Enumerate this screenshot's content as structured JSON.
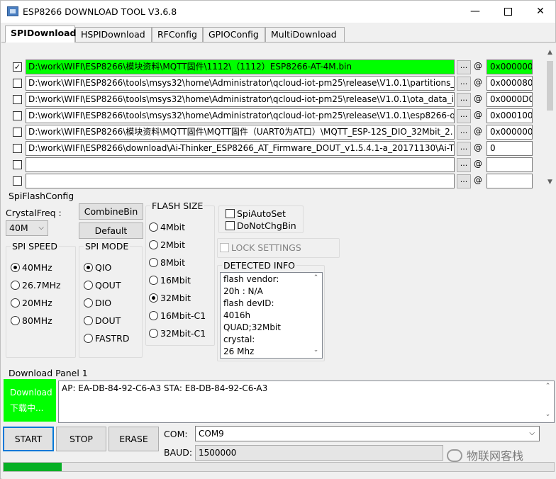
{
  "window": {
    "title": "ESP8266 DOWNLOAD TOOL V3.6.8",
    "min_glyph": "—",
    "close_glyph": "✕"
  },
  "tabs": [
    {
      "label": "SPIDownload",
      "active": true
    },
    {
      "label": "HSPIDownload"
    },
    {
      "label": "RFConfig"
    },
    {
      "label": "GPIOConfig"
    },
    {
      "label": "MultiDownload"
    }
  ],
  "files": [
    {
      "checked": true,
      "path": "D:\\work\\WIFI\\ESP8266\\模块资料\\MQTT固件\\1112\\（1112）ESP8266-AT-4M.bin",
      "addr": "0x000000",
      "highlight": true
    },
    {
      "checked": false,
      "path": "D:\\work\\WIFI\\ESP8266\\tools\\msys32\\home\\Administrator\\qcloud-iot-pm25\\release\\V1.0.1\\partitions_tv",
      "addr": "0x0000800"
    },
    {
      "checked": false,
      "path": "D:\\work\\WIFI\\ESP8266\\tools\\msys32\\home\\Administrator\\qcloud-iot-pm25\\release\\V1.0.1\\ota_data_ini",
      "addr": "0x0000D0"
    },
    {
      "checked": false,
      "path": "D:\\work\\WIFI\\ESP8266\\tools\\msys32\\home\\Administrator\\qcloud-iot-pm25\\release\\V1.0.1\\esp8266-qc",
      "addr": "0x0001000"
    },
    {
      "checked": false,
      "path": "D:\\work\\WIFI\\ESP8266\\模块资料\\MQTT固件\\MQTT固件（UART0为AT口）\\MQTT_ESP-12S_DIO_32Mbit_2.",
      "addr": "0x000000"
    },
    {
      "checked": false,
      "path": "D:\\work\\WIFI\\ESP8266\\download\\Ai-Thinker_ESP8266_AT_Firmware_DOUT_v1.5.4.1-a_20171130\\Ai-Thinl",
      "addr": "0"
    },
    {
      "checked": false,
      "path": "",
      "addr": ""
    },
    {
      "checked": false,
      "path": "",
      "addr": ""
    }
  ],
  "file_row_labels": {
    "browse": "...",
    "at": "@",
    "check_mark": "✓"
  },
  "spi_flash_config": {
    "label": "SpiFlashConfig",
    "crystal_freq_label": "CrystalFreq :",
    "crystal_freq_value": "40M",
    "combine_bin": "CombineBin",
    "default": "Default",
    "spi_speed": {
      "title": "SPI SPEED",
      "options": [
        "40MHz",
        "26.7MHz",
        "20MHz",
        "80MHz"
      ],
      "selected": 0
    },
    "spi_mode": {
      "title": "SPI MODE",
      "options": [
        "QIO",
        "QOUT",
        "DIO",
        "DOUT",
        "FASTRD"
      ],
      "selected": 0
    },
    "flash_size": {
      "title": "FLASH SIZE",
      "options": [
        "4Mbit",
        "2Mbit",
        "8Mbit",
        "16Mbit",
        "32Mbit",
        "16Mbit-C1",
        "32Mbit-C1"
      ],
      "selected": 4
    },
    "spi_auto_set": "SpiAutoSet",
    "do_not_chg_bin": "DoNotChgBin",
    "lock_settings": "LOCK SETTINGS"
  },
  "detected_info": {
    "title": "DETECTED INFO",
    "lines": [
      "flash vendor:",
      "20h : N/A",
      "flash devID:",
      "4016h",
      "QUAD;32Mbit",
      "crystal:",
      "26 Mhz"
    ]
  },
  "download_panel": {
    "label": "Download Panel 1",
    "status_line1": "Download",
    "status_line2": "下载中...",
    "log": "AP:  EA-DB-84-92-C6-A3  STA:  E8-DB-84-92-C6-A3"
  },
  "buttons": {
    "start": "START",
    "stop": "STOP",
    "erase": "ERASE"
  },
  "com": {
    "label": "COM:",
    "value": "COM9"
  },
  "baud": {
    "label": "BAUD:",
    "value": "1500000"
  },
  "progress": {
    "fraction": 0.106
  },
  "watermark": "物联网客栈",
  "colors": {
    "highlight_green": "#00ff00",
    "progress_green": "#06b025",
    "focus_blue": "#0078d7"
  }
}
